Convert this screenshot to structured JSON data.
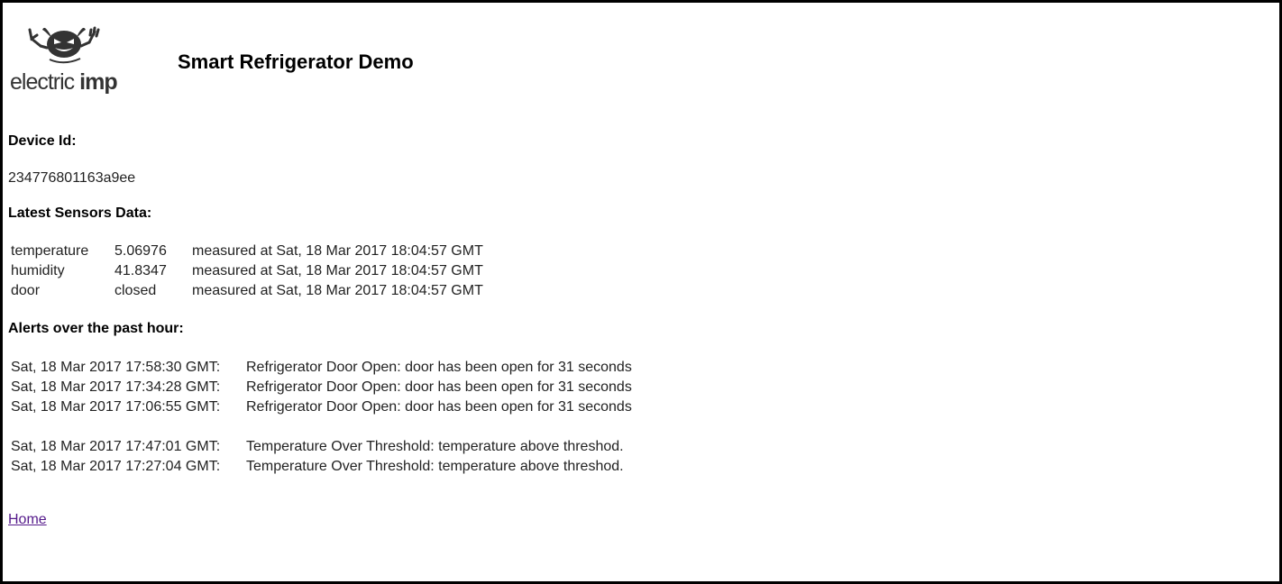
{
  "header": {
    "logo_text_1": "electric",
    "logo_text_2": "imp",
    "title": "Smart Refrigerator Demo"
  },
  "device": {
    "label": "Device Id:",
    "id": "234776801163a9ee"
  },
  "sensors": {
    "label": "Latest Sensors Data:",
    "rows": [
      {
        "name": "temperature",
        "value": "5.06976",
        "measured": "measured at Sat, 18 Mar 2017 18:04:57 GMT"
      },
      {
        "name": "humidity",
        "value": "41.8347",
        "measured": "measured at Sat, 18 Mar 2017 18:04:57 GMT"
      },
      {
        "name": "door",
        "value": "closed",
        "measured": "measured at Sat, 18 Mar 2017 18:04:57 GMT"
      }
    ]
  },
  "alerts": {
    "label": "Alerts over the past hour:",
    "door_alerts": [
      {
        "time": "Sat, 18 Mar 2017 17:58:30 GMT:",
        "message": "Refrigerator Door Open: door has been open for 31 seconds"
      },
      {
        "time": "Sat, 18 Mar 2017 17:34:28 GMT:",
        "message": "Refrigerator Door Open: door has been open for 31 seconds"
      },
      {
        "time": "Sat, 18 Mar 2017 17:06:55 GMT:",
        "message": "Refrigerator Door Open: door has been open for 31 seconds"
      }
    ],
    "temp_alerts": [
      {
        "time": "Sat, 18 Mar 2017 17:47:01 GMT:",
        "message": "Temperature Over Threshold: temperature above threshod."
      },
      {
        "time": "Sat, 18 Mar 2017 17:27:04 GMT:",
        "message": "Temperature Over Threshold: temperature above threshod."
      }
    ]
  },
  "footer": {
    "home_link": "Home"
  },
  "colors": {
    "link": "#551a8b",
    "border": "#000000"
  }
}
